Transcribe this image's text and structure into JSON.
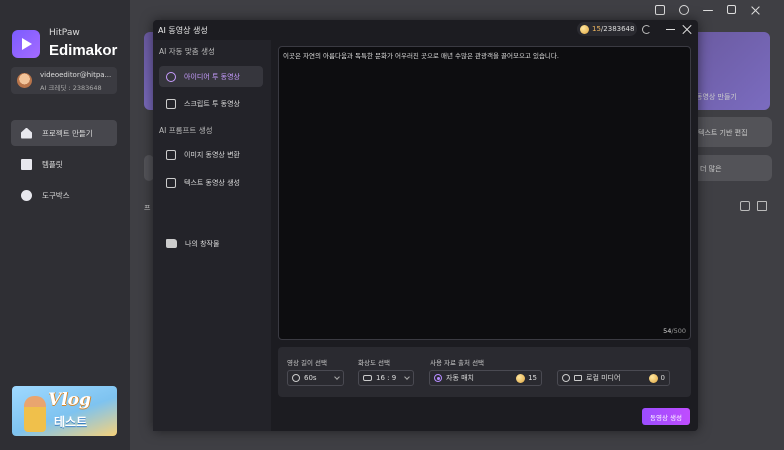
{
  "app": {
    "brand_top": "HitPaw",
    "brand_name": "Edimakor",
    "user_email": "videoeditor@hitpa...",
    "user_credits": "AI 크레딧 : 2383648",
    "nav": [
      {
        "label": "프로젝트 만들기",
        "icon": "house-icon"
      },
      {
        "label": "템플릿",
        "icon": "template-icon"
      },
      {
        "label": "도구박스",
        "icon": "toolbox-icon"
      }
    ],
    "banner_title": "Vlog",
    "banner_subtitle": "테스트",
    "bg_texts": {
      "card_video": "동영상 만들기",
      "text_edit": "텍스트 기반 편집",
      "more": "더 많은",
      "section": "프"
    }
  },
  "modal": {
    "title": "AI 동영상 생성",
    "credits_used": "15",
    "credits_total": "/2383648",
    "sections": {
      "auto": "AI 자동 맞춤 생성",
      "prompt": "AI 프롬프트 생성"
    },
    "items": {
      "idea": "아이디어 투 동영상",
      "script": "스크립트 투 동영상",
      "image": "이미지 동영상 변환",
      "text": "텍스트 동영상 생성",
      "mine": "나의 창작물"
    },
    "prompt_text": "이곳은 자연의 아름다움과 독특한 문화가 어우러진 곳으로 매년 수많은 관광객을 끌어모으고 있습니다.",
    "char_count": "54",
    "char_max": "/500",
    "settings": {
      "length_label": "영상 길이 선택",
      "length_value": "60s",
      "ratio_label": "화상도 선택",
      "ratio_value": "16 : 9",
      "source_label": "사용 자료 출처 선택",
      "auto_match": "자동 매치",
      "auto_cost": "15",
      "local_media": "로컬 미디어",
      "local_cost": "0"
    },
    "generate_label": "동영상 생성"
  }
}
